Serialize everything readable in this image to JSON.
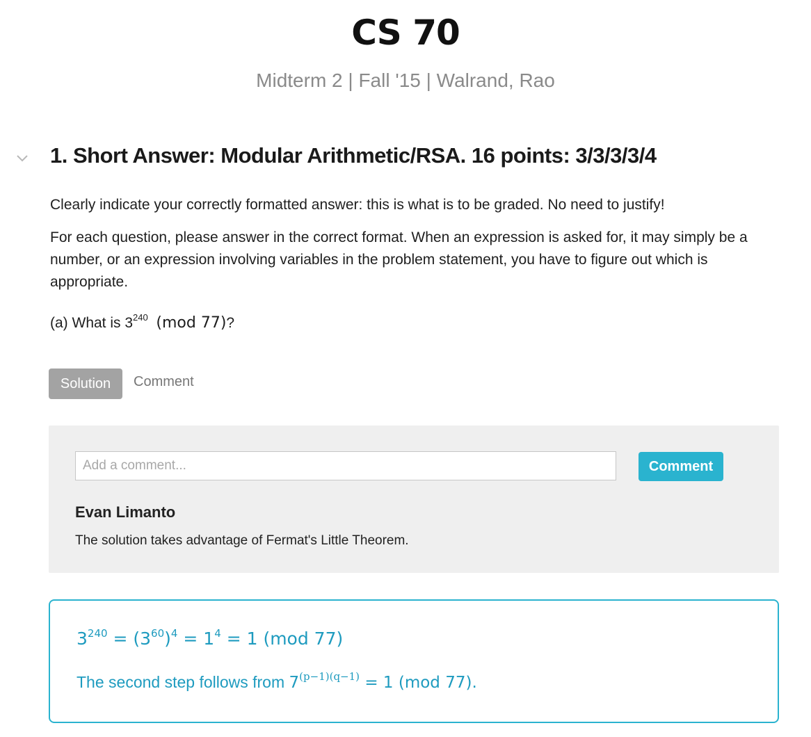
{
  "header": {
    "course_title": "CS 70",
    "subtitle": "Midterm 2 | Fall '15 | Walrand, Rao"
  },
  "question": {
    "toggle_icon": "chevron-down-icon",
    "heading": "1. Short Answer: Modular Arithmetic/RSA. 16 points: 3/3/3/3/4",
    "instructions_1": "Clearly indicate your correctly formatted answer: this is what is to be graded. No need to justify!",
    "instructions_2": "For each question, please answer in the correct format. When an expression is asked for, it may simply be a number, or an expression involving variables in the problem statement, you have to figure out which is appropriate.",
    "part_a": {
      "prefix": "(a) What is 3",
      "exponent": "240",
      "mod_expr": "(mod  77)",
      "suffix": "?"
    }
  },
  "tabs": {
    "solution_label": "Solution",
    "comment_label": "Comment"
  },
  "comments": {
    "input_placeholder": "Add a comment...",
    "submit_label": "Comment",
    "items": [
      {
        "author": "Evan Limanto",
        "text": "The solution takes advantage of Fermat's Little Theorem."
      }
    ]
  },
  "solution": {
    "line1": {
      "b1": "3",
      "e1": "240",
      "t1": " = (3",
      "e2": "60",
      "t2": ")",
      "e3": "4",
      "t3": " = 1",
      "e4": "4",
      "t4": " = 1  (mod  77)"
    },
    "line2": {
      "text": "The second step follows from ",
      "base": "7",
      "exponent": "(p−1)(q−1)",
      "rest": " = 1  (mod  77)."
    }
  },
  "colors": {
    "accent": "#2ab3cf",
    "solution_text": "#1e9bbf",
    "active_tab": "#a3a3a3",
    "subtitle": "#8a8a8a",
    "panel_bg": "#efefef"
  }
}
